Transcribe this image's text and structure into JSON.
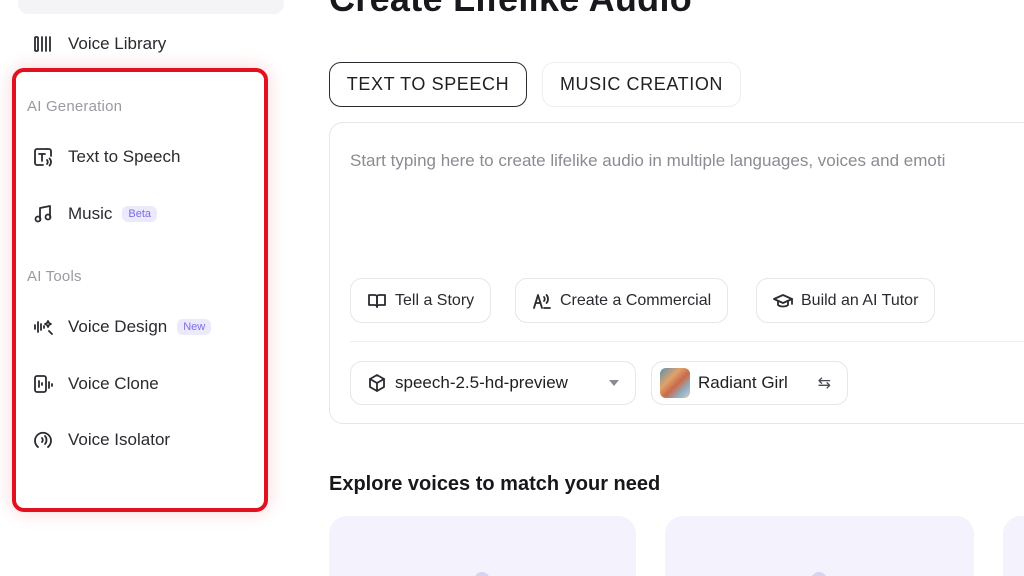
{
  "sidebar": {
    "voice_library": {
      "label": "Voice Library",
      "icon": "voice-library-icon"
    },
    "ai_generation": {
      "title": "AI Generation",
      "items": [
        {
          "label": "Text to Speech",
          "icon": "text-to-speech-icon"
        },
        {
          "label": "Music",
          "icon": "music-note-icon",
          "badge": "Beta"
        }
      ]
    },
    "ai_tools": {
      "title": "AI Tools",
      "items": [
        {
          "label": "Voice Design",
          "icon": "voice-design-icon",
          "badge": "New"
        },
        {
          "label": "Voice Clone",
          "icon": "voice-clone-icon"
        },
        {
          "label": "Voice Isolator",
          "icon": "voice-isolator-icon"
        }
      ]
    }
  },
  "main": {
    "title": "Create Lifelike Audio",
    "tabs": [
      {
        "label": "TEXT TO SPEECH",
        "active": true
      },
      {
        "label": "MUSIC CREATION",
        "active": false
      }
    ],
    "editor": {
      "placeholder": "Start typing here to create lifelike audio in multiple languages, voices and emoti",
      "prompts": [
        {
          "label": "Tell a Story",
          "icon": "book-icon"
        },
        {
          "label": "Create a Commercial",
          "icon": "commercial-icon"
        },
        {
          "label": "Build an AI Tutor",
          "icon": "graduation-cap-icon"
        }
      ],
      "model": "speech-2.5-hd-preview",
      "voice": "Radiant Girl"
    },
    "explore_heading": "Explore voices to match your need"
  },
  "colors": {
    "highlight": "#e3101f",
    "badge_bg": "#ece9fb",
    "badge_text": "#7b6ee6",
    "card_bg": "#f4f2fd"
  }
}
